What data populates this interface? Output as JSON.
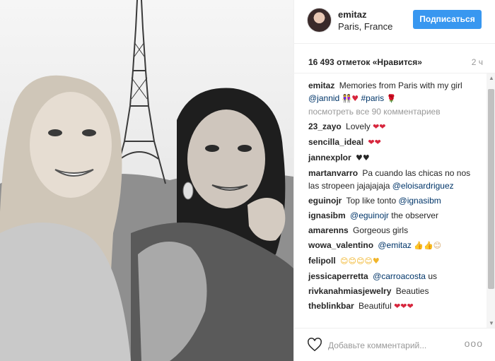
{
  "post": {
    "username": "emitaz",
    "location": "Paris, France",
    "follow_label": "Подписаться",
    "likes": "16 493 отметок «Нравится»",
    "time": "2 ч"
  },
  "caption": {
    "user": "emitaz",
    "text": "Memories from Paris with my girl",
    "mention": "@jannid",
    "emoji": "👭♥",
    "hashtag": "#paris",
    "emoji_end": "🌹"
  },
  "view_all": "посмотреть все 90 комментариев",
  "comments": [
    {
      "user": "23_zayo",
      "text": "Lovely",
      "emoji": "❤❤"
    },
    {
      "user": "sencilla_ideal",
      "text": "",
      "emoji": "❤❤"
    },
    {
      "user": "jannexplor",
      "text": "",
      "emoji": "♥♥"
    },
    {
      "user": "martanvarro",
      "text": "Pa cuando las chicas no nos las stropeen jajajajaja",
      "mention": "@eloisardriguez"
    },
    {
      "user": "eguinojr",
      "text": "Top like tonto",
      "mention": "@ignasibm"
    },
    {
      "user": "ignasibm",
      "text": "the observer",
      "mention": "@eguinojr"
    },
    {
      "user": "amarenns",
      "text": "Gorgeous girls"
    },
    {
      "user": "wowa_valentino",
      "text": "",
      "mention": "@emitaz",
      "emoji": "👍👍😊"
    },
    {
      "user": "felipoll",
      "text": "",
      "emoji": "😊😊😊😊♥"
    },
    {
      "user": "jessicaperretta",
      "text": "us",
      "mention": "@carroacosta"
    },
    {
      "user": "rivkanahmiasjewelry",
      "text": "Beauties"
    },
    {
      "user": "theblinkbar",
      "text": "Beautiful",
      "emoji": "❤❤❤"
    }
  ],
  "comment_box": {
    "placeholder": "Добавьте комментарий...",
    "more": "ооо"
  },
  "colors": {
    "follow_button": "#3897f0",
    "link": "#003569",
    "muted": "#999999",
    "heart_red": "#d7263d"
  },
  "icons": [
    "heart-icon",
    "more-icon",
    "scroll-up-arrow",
    "scroll-down-arrow"
  ]
}
